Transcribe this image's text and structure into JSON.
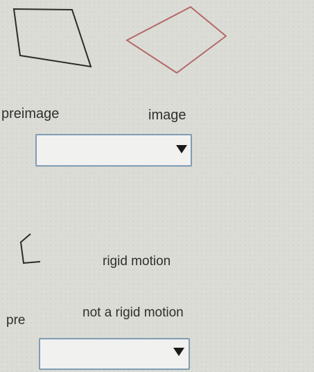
{
  "figure": {
    "preimage_label": "preimage",
    "image_label": "image",
    "preimage_color": "#2b2b2b",
    "image_color": "#b36a6a"
  },
  "dropdown1": {
    "selected": "",
    "caret_icon": "triangle-down-icon"
  },
  "second_question": {
    "label_fragment": "pre",
    "options": [
      "rigid motion",
      "not a rigid motion"
    ]
  },
  "dropdown2": {
    "selected": "",
    "caret_icon": "triangle-down-icon"
  }
}
